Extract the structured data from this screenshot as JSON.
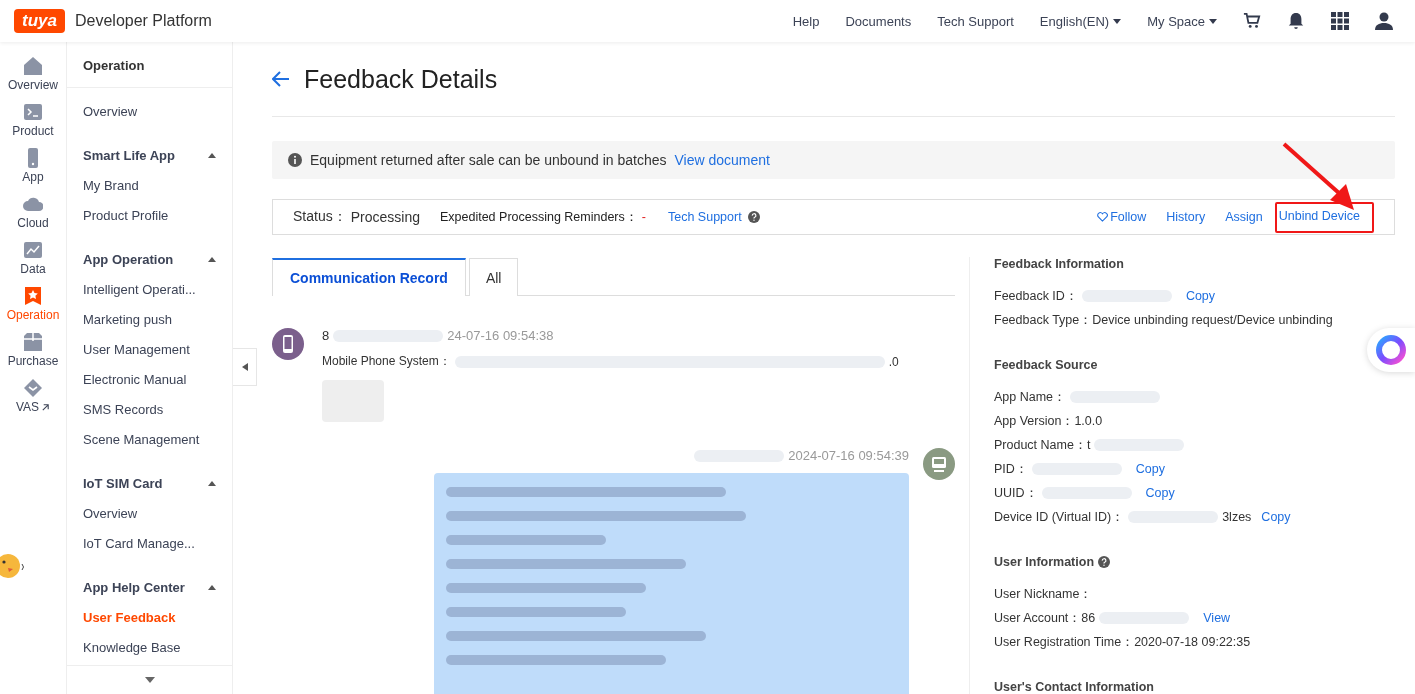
{
  "header": {
    "logo": "tuya",
    "title": "Developer Platform",
    "nav": [
      {
        "label": "Help",
        "kind": "link"
      },
      {
        "label": "Documents",
        "kind": "link"
      },
      {
        "label": "Tech Support",
        "kind": "link"
      },
      {
        "label": "English(EN)",
        "kind": "dropdown"
      },
      {
        "label": "My Space",
        "kind": "dropdown"
      }
    ]
  },
  "rail": [
    {
      "label": "Overview",
      "kind": "home",
      "selected": false,
      "external": false
    },
    {
      "label": "Product",
      "kind": "terminal",
      "selected": false,
      "external": false
    },
    {
      "label": "App",
      "kind": "phone",
      "selected": false,
      "external": false
    },
    {
      "label": "Cloud",
      "kind": "cloud",
      "selected": false,
      "external": false
    },
    {
      "label": "Data",
      "kind": "chart",
      "selected": false,
      "external": false
    },
    {
      "label": "Operation",
      "kind": "star",
      "selected": true,
      "external": false
    },
    {
      "label": "Purchase",
      "kind": "box",
      "selected": false,
      "external": false
    },
    {
      "label": "VAS",
      "kind": "diamond",
      "selected": false,
      "external": true
    }
  ],
  "submenu": {
    "title": "Operation",
    "groups": [
      {
        "items": [
          {
            "label": "Overview",
            "selected": false
          }
        ]
      },
      {
        "title": "Smart Life App",
        "expanded": true,
        "items": [
          {
            "label": "My Brand",
            "selected": false
          },
          {
            "label": "Product Profile",
            "selected": false
          }
        ]
      },
      {
        "title": "App Operation",
        "expanded": true,
        "items": [
          {
            "label": "Intelligent Operati...",
            "selected": false
          },
          {
            "label": "Marketing push",
            "selected": false
          },
          {
            "label": "User Management",
            "selected": false
          },
          {
            "label": "Electronic Manual",
            "selected": false
          },
          {
            "label": "SMS Records",
            "selected": false
          },
          {
            "label": "Scene Management",
            "selected": false
          }
        ]
      },
      {
        "title": "IoT SIM Card",
        "expanded": true,
        "items": [
          {
            "label": "Overview",
            "selected": false
          },
          {
            "label": "IoT Card Manage...",
            "selected": false
          }
        ]
      },
      {
        "title": "App Help Center",
        "expanded": true,
        "items": [
          {
            "label": "User Feedback",
            "selected": true
          },
          {
            "label": "Knowledge Base",
            "selected": false
          }
        ]
      }
    ]
  },
  "page": {
    "title": "Feedback Details",
    "notice": {
      "text": "Equipment returned after sale can be unbound in batches",
      "link": "View document"
    },
    "status": {
      "label": "Status：",
      "value": "Processing",
      "reminder_label": "Expedited Processing Reminders：",
      "reminder_value": "-",
      "support": "Tech Support",
      "actions": [
        {
          "label": "Follow",
          "kind": "follow",
          "highlighted": false
        },
        {
          "label": "History",
          "kind": "link",
          "highlighted": false
        },
        {
          "label": "Assign",
          "kind": "link",
          "highlighted": false
        },
        {
          "label": "Unbind Device",
          "kind": "link",
          "highlighted": true
        }
      ]
    },
    "tabs": [
      {
        "label": "Communication Record",
        "selected": true
      },
      {
        "label": "All",
        "selected": false
      }
    ],
    "messages": [
      {
        "kind": "incoming",
        "sender": "8",
        "time": "24-07-16 09:54:38",
        "meta_label": "Mobile Phone System：",
        "meta_tail": ".0"
      },
      {
        "kind": "outgoing",
        "time": "2024-07-16 09:54:39"
      }
    ],
    "info": [
      {
        "heading": "Feedback Information",
        "rows": [
          {
            "kind": "masked",
            "label": "Feedback ID：",
            "action": "Copy"
          },
          {
            "kind": "plain",
            "label": "Feedback Type：",
            "value": "Device unbinding request/Device unbinding"
          }
        ]
      },
      {
        "heading": "Feedback Source",
        "rows": [
          {
            "kind": "masked",
            "label": "App Name："
          },
          {
            "kind": "plain",
            "label": "App Version：",
            "value": "1.0.0"
          },
          {
            "kind": "masked",
            "label": "Product Name：",
            "value": "t"
          },
          {
            "kind": "masked",
            "label": "PID：",
            "action": "Copy"
          },
          {
            "kind": "masked",
            "label": "UUID：",
            "action": "Copy"
          },
          {
            "kind": "masked",
            "label": "Device ID (Virtual ID)：",
            "tail": "3lzes",
            "action": "Copy"
          }
        ]
      },
      {
        "heading": "User Information",
        "help": true,
        "rows": [
          {
            "kind": "plain",
            "label": "User Nickname："
          },
          {
            "kind": "masked",
            "label": "User Account：",
            "value": "86",
            "action": "View"
          },
          {
            "kind": "plain",
            "label": "User Registration Time：",
            "value": "2020-07-18 09:22:35"
          }
        ]
      },
      {
        "heading": "User's Contact Information"
      }
    ]
  }
}
